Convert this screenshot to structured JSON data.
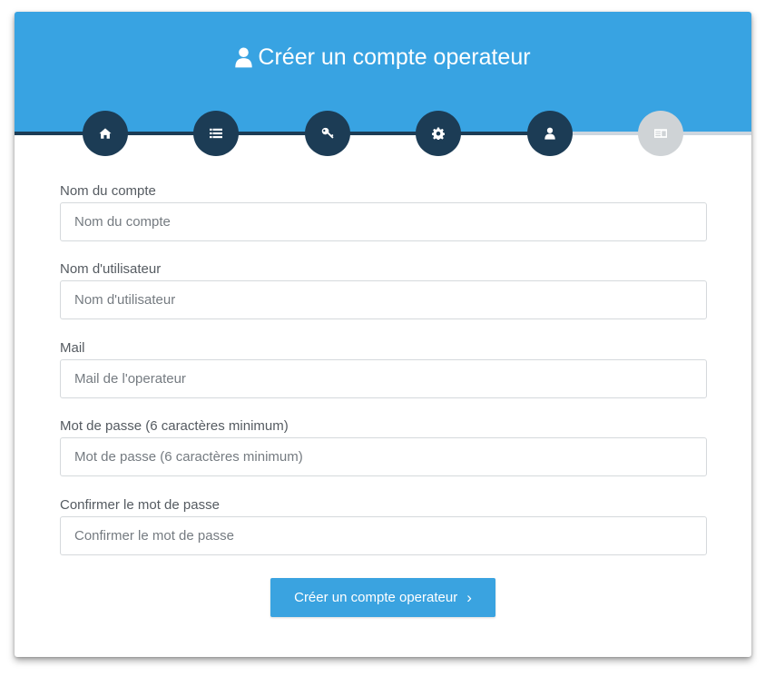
{
  "header": {
    "title": "Créer un compte operateur",
    "title_icon": "user-icon",
    "background_color": "#38a3e2"
  },
  "steps": {
    "completed_color": "#1c3c55",
    "inactive_color": "#cfd3d6",
    "items": [
      {
        "icon": "home-icon",
        "state": "completed"
      },
      {
        "icon": "list-icon",
        "state": "completed"
      },
      {
        "icon": "key-icon",
        "state": "completed"
      },
      {
        "icon": "gear-icon",
        "state": "completed"
      },
      {
        "icon": "user-icon",
        "state": "current"
      },
      {
        "icon": "id-card-icon",
        "state": "inactive"
      }
    ]
  },
  "form": {
    "fields": [
      {
        "label": "Nom du compte",
        "placeholder": "Nom du compte",
        "value": ""
      },
      {
        "label": "Nom d'utilisateur",
        "placeholder": "Nom d'utilisateur",
        "value": ""
      },
      {
        "label": "Mail",
        "placeholder": "Mail de l'operateur",
        "value": ""
      },
      {
        "label": "Mot de passe (6 caractères minimum)",
        "placeholder": "Mot de passe (6 caractères minimum)",
        "value": ""
      },
      {
        "label": "Confirmer le mot de passe",
        "placeholder": "Confirmer le mot de passe",
        "value": ""
      }
    ],
    "submit_label": "Créer un compte operateur",
    "submit_icon": "chevron-right-icon",
    "submit_color": "#3aa3e0"
  }
}
